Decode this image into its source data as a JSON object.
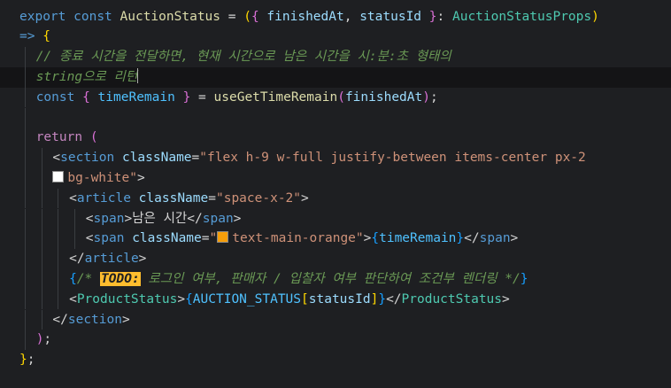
{
  "editor": {
    "colors": {
      "background": "#1e1f22",
      "todo_highlight": "#ffbd2e",
      "swatch_white": "#ffffff",
      "swatch_orange": "#f59e0b"
    },
    "lines": [
      {
        "tokens": [
          {
            "t": "export",
            "c": "kw"
          },
          {
            "t": " "
          },
          {
            "t": "const",
            "c": "kw"
          },
          {
            "t": " "
          },
          {
            "t": "AuctionStatus",
            "c": "fn"
          },
          {
            "t": " = "
          },
          {
            "t": "(",
            "c": "paren1"
          },
          {
            "t": "{",
            "c": "paren2"
          },
          {
            "t": " "
          },
          {
            "t": "finishedAt",
            "c": "param"
          },
          {
            "t": ", "
          },
          {
            "t": "statusId",
            "c": "param"
          },
          {
            "t": " "
          },
          {
            "t": "}",
            "c": "paren2"
          },
          {
            "t": ": "
          },
          {
            "t": "AuctionStatusProps",
            "c": "type"
          },
          {
            "t": ")",
            "c": "paren1"
          }
        ]
      },
      {
        "tokens": [
          {
            "t": "=>",
            "c": "kw"
          },
          {
            "t": " "
          },
          {
            "t": "{",
            "c": "paren1"
          }
        ]
      },
      {
        "indent": 1,
        "tokens": [
          {
            "t": "// 종료 시간을 전달하면, 현재 시간으로 남은 시간을 시:분:초 형태의",
            "c": "comment"
          }
        ]
      },
      {
        "indent": 1,
        "current": true,
        "tokens": [
          {
            "t": "string으로 리턴",
            "c": "comment"
          },
          {
            "t": "",
            "cursor": true
          }
        ]
      },
      {
        "indent": 1,
        "tokens": [
          {
            "t": "const",
            "c": "kw"
          },
          {
            "t": " "
          },
          {
            "t": "{",
            "c": "paren2"
          },
          {
            "t": " "
          },
          {
            "t": "timeRemain",
            "c": "const"
          },
          {
            "t": " "
          },
          {
            "t": "}",
            "c": "paren2"
          },
          {
            "t": " = "
          },
          {
            "t": "useGetTimeRemain",
            "c": "fn"
          },
          {
            "t": "(",
            "c": "paren2"
          },
          {
            "t": "finishedAt",
            "c": "var"
          },
          {
            "t": ")",
            "c": "paren2"
          },
          {
            "t": ";"
          }
        ]
      },
      {
        "indent": 1,
        "tokens": []
      },
      {
        "indent": 1,
        "tokens": [
          {
            "t": "return",
            "c": "ctl"
          },
          {
            "t": " "
          },
          {
            "t": "(",
            "c": "paren2"
          }
        ]
      },
      {
        "indent": 2,
        "tokens": [
          {
            "t": "<",
            "c": "punc"
          },
          {
            "t": "section",
            "c": "tag"
          },
          {
            "t": " "
          },
          {
            "t": "className",
            "c": "attr"
          },
          {
            "t": "="
          },
          {
            "t": "\"flex h-9 w-full justify-between items-center px-2",
            "c": "str"
          }
        ]
      },
      {
        "indent": 2,
        "tokens": [
          {
            "t": "",
            "swatch": "white"
          },
          {
            "t": "bg-white\"",
            "c": "str"
          },
          {
            "t": ">"
          }
        ]
      },
      {
        "indent": 3,
        "tokens": [
          {
            "t": "<"
          },
          {
            "t": "article",
            "c": "tag"
          },
          {
            "t": " "
          },
          {
            "t": "className",
            "c": "attr"
          },
          {
            "t": "="
          },
          {
            "t": "\"space-x-2\"",
            "c": "str"
          },
          {
            "t": ">"
          }
        ]
      },
      {
        "indent": 4,
        "tokens": [
          {
            "t": "<"
          },
          {
            "t": "span",
            "c": "tag"
          },
          {
            "t": ">"
          },
          {
            "t": "남은 시간"
          },
          {
            "t": "</"
          },
          {
            "t": "span",
            "c": "tag"
          },
          {
            "t": ">"
          }
        ]
      },
      {
        "indent": 4,
        "tokens": [
          {
            "t": "<"
          },
          {
            "t": "span",
            "c": "tag"
          },
          {
            "t": " "
          },
          {
            "t": "className",
            "c": "attr"
          },
          {
            "t": "="
          },
          {
            "t": "\"",
            "c": "str"
          },
          {
            "t": "",
            "swatch": "orange"
          },
          {
            "t": "text-main-orange\"",
            "c": "str"
          },
          {
            "t": ">"
          },
          {
            "t": "{",
            "c": "paren3"
          },
          {
            "t": "timeRemain",
            "c": "const"
          },
          {
            "t": "}",
            "c": "paren3"
          },
          {
            "t": "</"
          },
          {
            "t": "span",
            "c": "tag"
          },
          {
            "t": ">"
          }
        ]
      },
      {
        "indent": 3,
        "tokens": [
          {
            "t": "</"
          },
          {
            "t": "article",
            "c": "tag"
          },
          {
            "t": ">"
          }
        ]
      },
      {
        "indent": 3,
        "tokens": [
          {
            "t": "{",
            "c": "paren3"
          },
          {
            "t": "/* ",
            "c": "comment"
          },
          {
            "t": "TODO:",
            "c": "todo"
          },
          {
            "t": " 로그인 여부, 판매자 / 입찰자 여부 판단하여 조건부 렌더링 */",
            "c": "comment"
          },
          {
            "t": "}",
            "c": "paren3"
          }
        ]
      },
      {
        "indent": 3,
        "tokens": [
          {
            "t": "<"
          },
          {
            "t": "ProductStatus",
            "c": "type"
          },
          {
            "t": ">"
          },
          {
            "t": "{",
            "c": "paren3"
          },
          {
            "t": "AUCTION_STATUS",
            "c": "const"
          },
          {
            "t": "[",
            "c": "paren1"
          },
          {
            "t": "statusId",
            "c": "var"
          },
          {
            "t": "]",
            "c": "paren1"
          },
          {
            "t": "}",
            "c": "paren3"
          },
          {
            "t": "</"
          },
          {
            "t": "ProductStatus",
            "c": "type"
          },
          {
            "t": ">"
          }
        ]
      },
      {
        "indent": 2,
        "tokens": [
          {
            "t": "</"
          },
          {
            "t": "section",
            "c": "tag"
          },
          {
            "t": ">"
          }
        ]
      },
      {
        "indent": 1,
        "tokens": [
          {
            "t": ")",
            "c": "paren2"
          },
          {
            "t": ";"
          }
        ]
      },
      {
        "tokens": [
          {
            "t": "}",
            "c": "paren1"
          },
          {
            "t": ";"
          }
        ]
      }
    ]
  }
}
